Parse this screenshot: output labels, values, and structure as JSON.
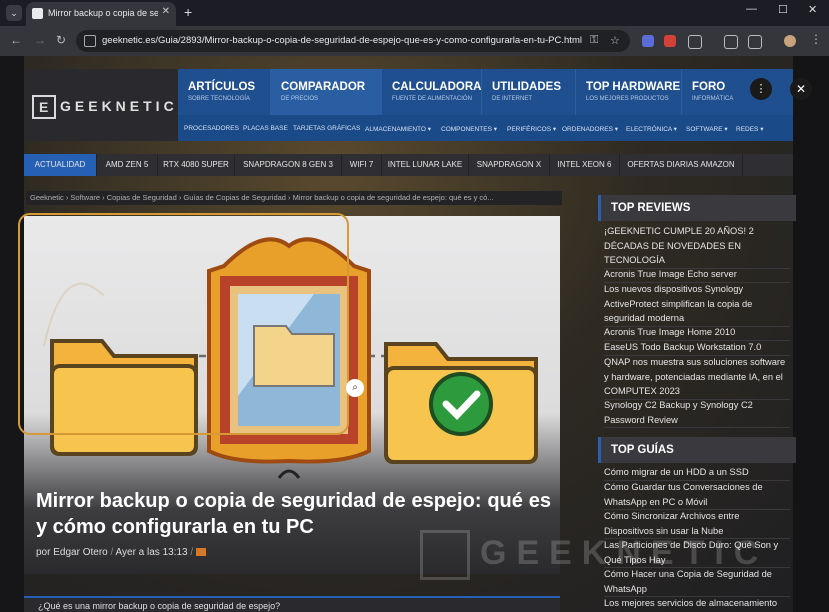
{
  "browser": {
    "tab_title": "Mirror backup o copia de segu",
    "url": "geeknetic.es/Guia/2893/Mirror-backup-o-copia-de-seguridad-de-espejo-que-es-y-como-configurarla-en-tu-PC.html"
  },
  "site": {
    "logo_text": "GEEKNETIC",
    "logo_letter": "E",
    "main_nav": [
      {
        "title": "ARTÍCULOS",
        "sub": "SOBRE TECNOLOGÍA"
      },
      {
        "title": "COMPARADOR",
        "sub": "DE PRECIOS"
      },
      {
        "title": "CALCULADORA",
        "sub": "FUENTE DE ALIMENTACIÓN"
      },
      {
        "title": "UTILIDADES",
        "sub": "DE INTERNET"
      },
      {
        "title": "TOP HARDWARE",
        "sub": "LOS MEJORES PRODUCTOS"
      },
      {
        "title": "FORO",
        "sub": "INFORMÁTICA"
      }
    ],
    "sub_nav": [
      "PROCESADORES",
      "PLACAS BASE",
      "TARJETAS GRÁFICAS",
      "ALMACENAMIENTO ▾",
      "COMPONENTES ▾",
      "PERIFÉRICOS ▾",
      "ORDENADORES ▾",
      "ELECTRÓNICA ▾",
      "SOFTWARE ▾",
      "REDES ▾"
    ],
    "topics": [
      "ACTUALIDAD",
      "AMD ZEN 5",
      "RTX 4080 SUPER",
      "SNAPDRAGON 8 GEN 3",
      "WIFI 7",
      "INTEL LUNAR LAKE",
      "SNAPDRAGON X",
      "INTEL XEON 6",
      "OFERTAS DIARIAS AMAZON"
    ]
  },
  "breadcrumb": "Geeknetic › Software › Copias de Seguridad › Guías de Copias de Seguridad › Mirror backup o copia de seguridad de espejo: qué es y có...",
  "article": {
    "title": "Mirror backup o copia de seguridad de espejo: qué es y cómo configurarla en tu PC",
    "author": "por Edgar Otero",
    "date": "Ayer a las 13:13",
    "subheading": "¿Qué es una mirror backup o copia de seguridad de espejo?"
  },
  "sidebar": {
    "top_reviews_title": "TOP REVIEWS",
    "top_reviews": [
      "¡GEEKNETIC CUMPLE 20 AÑOS! 2 DÉCADAS DE NOVEDADES EN TECNOLOGÍA",
      "Acronis True Image Echo server",
      "Los nuevos dispositivos Synology ActiveProtect simplifican la copia de seguridad moderna",
      "Acronis True Image Home 2010",
      "EaseUS Todo Backup Workstation 7.0",
      "QNAP nos muestra sus soluciones software y hardware, potenciadas mediante IA, en el COMPUTEX 2023",
      "Synology C2 Backup y Synology C2 Password Review"
    ],
    "top_guias_title": "TOP GUÍAS",
    "top_guias": [
      "Cómo migrar de un HDD a un SSD",
      "Cómo Guardar tus Conversaciones de WhatsApp en PC o Móvil",
      "Cómo Sincronizar Archivos entre Dispositivos sin usar la Nube",
      "Las Particiones de Disco Duro: Qué Son y Qué Tipos Hay",
      "Cómo Hacer una Copia de Seguridad de WhatsApp",
      "Los mejores servicios de almacenamiento"
    ]
  },
  "watermark": "GEEKNETIC",
  "colors": {
    "accent": "#2660b4",
    "nav": "#1f4f8f",
    "selection": "#d59a36",
    "check": "#2e9a3e"
  }
}
